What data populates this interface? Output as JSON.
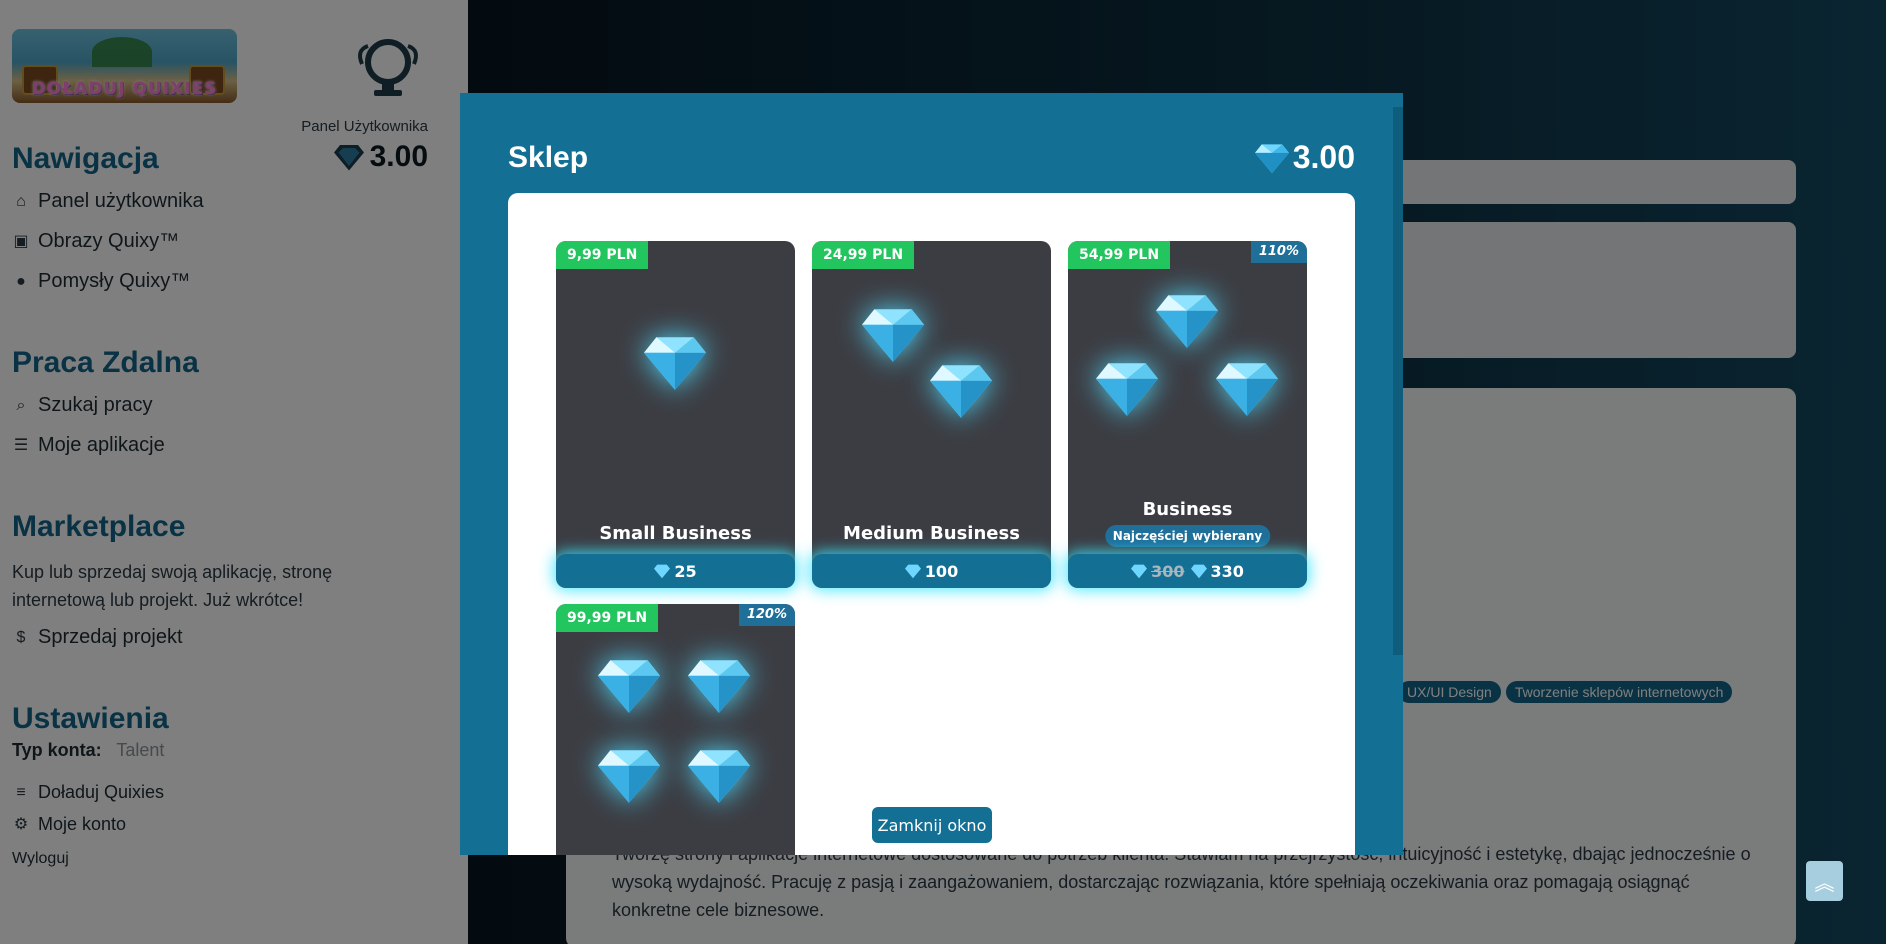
{
  "sidebar": {
    "logo_text": "DOŁADUJ QUIXIES",
    "panel_label": "Panel Użytkownika",
    "balance": "3.00",
    "nav_heading": "Nawigacja",
    "nav_items": [
      {
        "label": "Panel użytkownika",
        "icon": "home-icon"
      },
      {
        "label": "Obrazy Quixy™",
        "icon": "image-icon"
      },
      {
        "label": "Pomysły Quixy™",
        "icon": "lightbulb-icon"
      }
    ],
    "remote_heading": "Praca Zdalna",
    "remote_items": [
      {
        "label": "Szukaj pracy",
        "icon": "search-icon"
      },
      {
        "label": "Moje aplikacje",
        "icon": "list-icon"
      }
    ],
    "market_heading": "Marketplace",
    "market_text": "Kup lub sprzedaj swoją aplikację, stronę internetową lub projekt. Już wkrótce!",
    "market_item": {
      "label": "Sprzedaj projekt",
      "icon": "dollar-icon"
    },
    "settings_heading": "Ustawienia",
    "account_type_label": "Typ konta:",
    "account_type_value": "Talent",
    "settings_items": [
      {
        "label": "Doładuj Quixies",
        "icon": "coins-icon"
      },
      {
        "label": "Moje konto",
        "icon": "gear-icon"
      }
    ],
    "logout": "Wyloguj"
  },
  "main": {
    "tags": [
      "UX/UI Design",
      "Tworzenie sklepów internetowych"
    ],
    "description": "Tworzę strony i aplikacje internetowe dostosowane do potrzeb klienta. Stawiam na przejrzystość, intuicyjność i estetykę, dbając jednocześnie o wysoką wydajność. Pracuję z pasją i zaangażowaniem, dostarczając rozwiązania, które spełniają oczekiwania oraz pomagają osiągnąć konkretne cele biznesowe."
  },
  "modal": {
    "title": "Sklep",
    "balance": "3.00",
    "close_label": "Zamknij okno",
    "packages": [
      {
        "price": "9,99 PLN",
        "name": "Small Business",
        "gems": "25",
        "bonus": "",
        "old_gems": "",
        "popular": ""
      },
      {
        "price": "24,99 PLN",
        "name": "Medium Business",
        "gems": "100",
        "bonus": "",
        "old_gems": "",
        "popular": ""
      },
      {
        "price": "54,99 PLN",
        "name": "Business",
        "gems": "330",
        "bonus": "110%",
        "old_gems": "300",
        "popular": "Najczęściej wybierany"
      },
      {
        "price": "99,99 PLN",
        "name": "",
        "gems": "",
        "bonus": "120%",
        "old_gems": "",
        "popular": ""
      }
    ]
  },
  "colors": {
    "accent": "#136f94",
    "price_badge": "#22c55e",
    "card_bg": "#3c3d43",
    "heading": "#12658a"
  }
}
